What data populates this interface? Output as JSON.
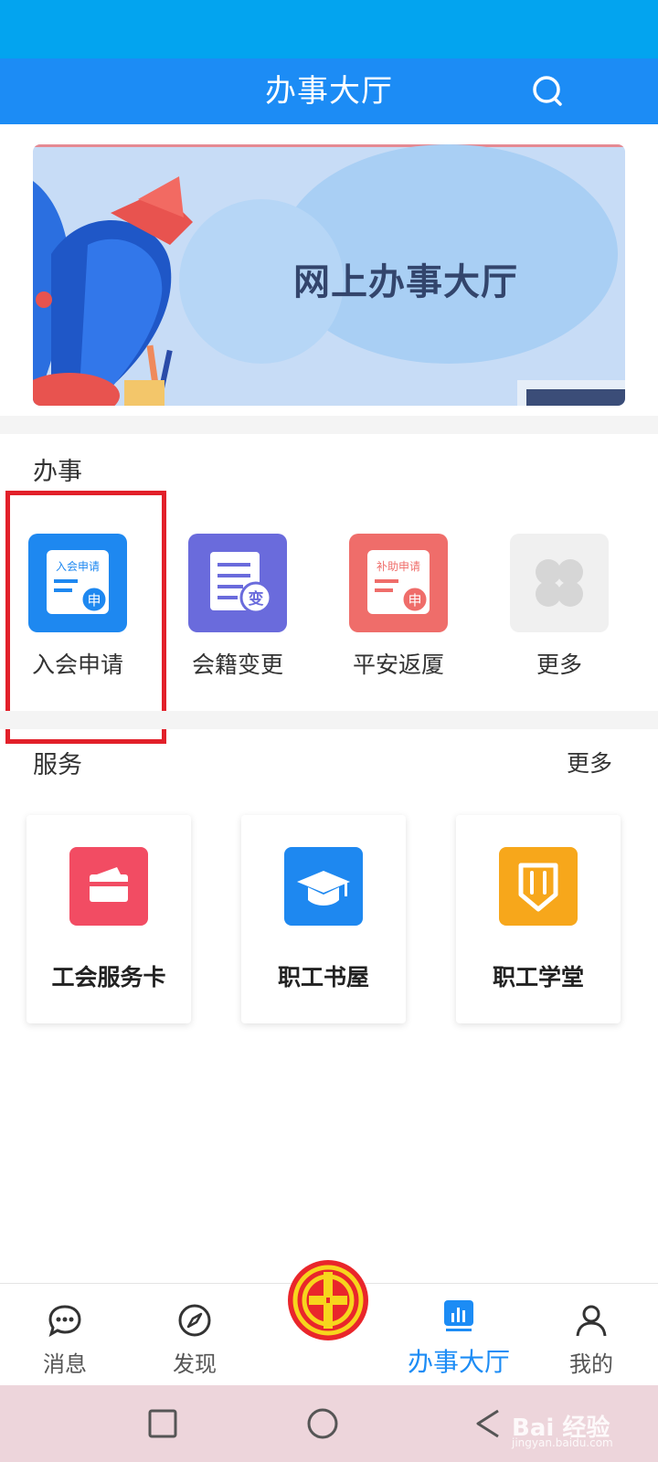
{
  "header": {
    "title": "办事大厅"
  },
  "banner": {
    "title": "网上办事大厅"
  },
  "tasks": {
    "section_label": "办事",
    "items": [
      {
        "label": "入会申请",
        "icon": "join-application-icon",
        "icon_text": "入会申请",
        "badge": "申",
        "color": "#1e88f0"
      },
      {
        "label": "会籍变更",
        "icon": "membership-change-icon",
        "badge": "变",
        "color": "#6a6bdc"
      },
      {
        "label": "平安返厦",
        "icon": "subsidy-application-icon",
        "icon_text": "补助申请",
        "badge": "申",
        "color": "#ef6d6a"
      },
      {
        "label": "更多",
        "icon": "more-grid-icon",
        "color": "#f0f0f0"
      }
    ]
  },
  "services": {
    "section_label": "服务",
    "more_label": "更多",
    "items": [
      {
        "label": "工会服务卡",
        "icon": "card-icon",
        "color": "#f24c63"
      },
      {
        "label": "职工书屋",
        "icon": "graduation-cap-icon",
        "color": "#1e88f0"
      },
      {
        "label": "职工学堂",
        "icon": "pencil-badge-icon",
        "color": "#f7a71b"
      }
    ]
  },
  "tabbar": {
    "items": [
      {
        "label": "消息",
        "icon": "chat-bubble-icon",
        "active": false
      },
      {
        "label": "发现",
        "icon": "compass-icon",
        "active": false
      },
      {
        "label": "办事大厅",
        "icon": "bar-chart-icon",
        "active": true
      },
      {
        "label": "我的",
        "icon": "person-icon",
        "active": false
      }
    ],
    "center_logo": "trade-union-logo"
  },
  "colors": {
    "status_bar": "#03a4ef",
    "header": "#1c8cf5",
    "accent": "#1c8cf5",
    "highlight": "#e2202a"
  },
  "watermark": {
    "text": "Bai 经验",
    "sub": "jingyan.baidu.com"
  }
}
